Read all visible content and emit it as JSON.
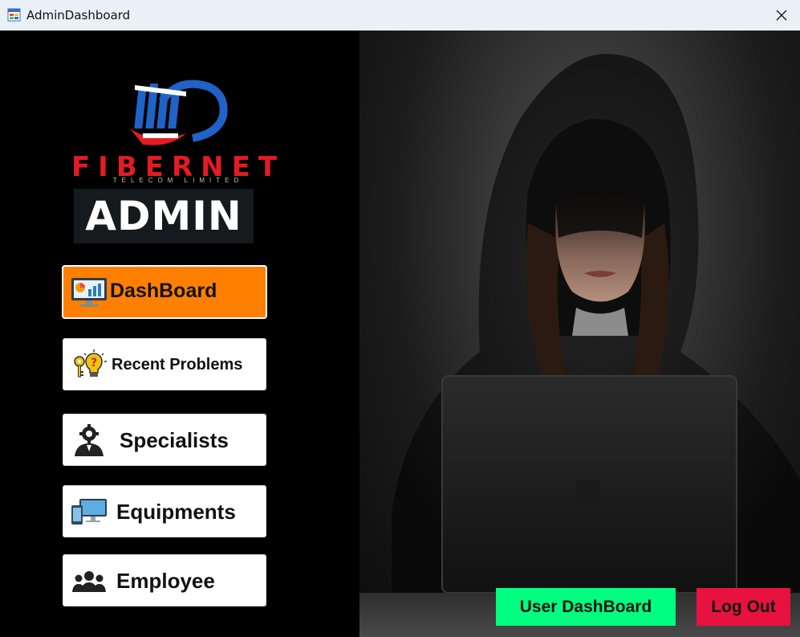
{
  "window": {
    "title": "AdminDashboard",
    "close_icon": "close-icon",
    "app_icon": "app-form-icon"
  },
  "logo": {
    "name": "FIBERNET",
    "subtitle": "TELECOM LIMITED"
  },
  "role_badge": "ADMIN",
  "sidebar": {
    "items": [
      {
        "label": "DashBoard",
        "icon": "dashboard-monitor-icon",
        "active": true
      },
      {
        "label": "Recent Problems",
        "icon": "key-lightbulb-icon",
        "active": false
      },
      {
        "label": "Specialists",
        "icon": "specialist-gear-person-icon",
        "active": false
      },
      {
        "label": "Equipments",
        "icon": "devices-icon",
        "active": false
      },
      {
        "label": "Employee",
        "icon": "group-people-icon",
        "active": false
      }
    ]
  },
  "actions": {
    "user_dashboard": "User DashBoard",
    "log_out": "Log Out"
  },
  "colors": {
    "active_item": "#ff7f00",
    "user_dashboard_btn": "#00ff80",
    "logout_btn": "#e8123e",
    "logo_red": "#e31b23",
    "logo_blue": "#1f63c6"
  }
}
